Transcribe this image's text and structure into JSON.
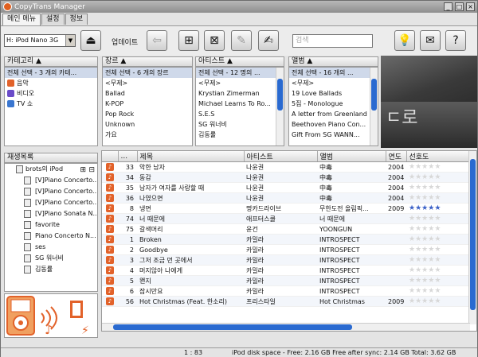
{
  "window": {
    "title": "CopyTrans Manager"
  },
  "tabs": [
    "메인 메뉴",
    "설정",
    "정보"
  ],
  "toolbar": {
    "device": "H: iPod Nano 3G",
    "update_label": "업데이트",
    "search_placeholder": "검색",
    "icons": [
      "eject-icon",
      "update-icon",
      "add-track-icon",
      "delete-track-icon",
      "edit-tags-icon",
      "edit-icon",
      "tips-icon",
      "mail-icon",
      "help-icon"
    ]
  },
  "categories": {
    "header": "카테고리",
    "items": [
      "전체 선택 - 3 개의 카테...",
      "음악",
      "비디오",
      "TV 쇼"
    ],
    "icon_colors": [
      "",
      "#e2622a",
      "#6a4bc9",
      "#3a76d0"
    ]
  },
  "genres": {
    "header": "장르",
    "items": [
      "전체 선택 - 6 개의 장르",
      "<무제>",
      "Ballad",
      "K-POP",
      "Pop Rock",
      "Unknown",
      "가요"
    ]
  },
  "artists": {
    "header": "아티스트",
    "items": [
      "전체 선택 - 12 명의 ...",
      "<무제>",
      "Krystian Zimerman",
      "Michael Learns To Ro...",
      "S.E.S",
      "SG 워너비",
      "김동률"
    ]
  },
  "albums": {
    "header": "앨범",
    "items": [
      "전체 선택 - 16 개의 ...",
      "<무제>",
      "19 Love Ballads",
      "5집 - Monologue",
      "A letter from Greenland",
      "Beethoven Piano Con...",
      "Gift From SG WANN..."
    ]
  },
  "album_art_text": "ㄷ로",
  "playlists": {
    "header": "재생목록",
    "root": "brots의 iPod",
    "items": [
      "[V]Piano Concerto...",
      "[V]Piano Concerto...",
      "[V]Piano Concerto...",
      "[V]Piano Sonata N...",
      "favorite",
      "Piano Concerto N...",
      "ses",
      "SG 워너비",
      "김동률"
    ]
  },
  "grid": {
    "columns": [
      "",
      "...",
      "제목",
      "아티스트",
      "앨범",
      "연도",
      "선호도"
    ],
    "rows": [
      {
        "n": "33",
        "title": "악한 남자",
        "artist": "나윤권",
        "album": "中毒",
        "year": "2004",
        "rating": 0
      },
      {
        "n": "34",
        "title": "동감",
        "artist": "나윤권",
        "album": "中毒",
        "year": "2004",
        "rating": 0
      },
      {
        "n": "35",
        "title": "남자가 여자를 사랑할 때",
        "artist": "나윤권",
        "album": "中毒",
        "year": "2004",
        "rating": 0
      },
      {
        "n": "36",
        "title": "나였으면",
        "artist": "나윤권",
        "album": "中毒",
        "year": "2004",
        "rating": 0
      },
      {
        "n": "8",
        "title": "냉면",
        "artist": "명카드라이브",
        "album": "무한도전 올림픽...",
        "year": "2009",
        "rating": 5
      },
      {
        "n": "74",
        "title": "너 때문에",
        "artist": "애프터스쿨",
        "album": "너 때문에",
        "year": "",
        "rating": 0
      },
      {
        "n": "75",
        "title": "갈색머리",
        "artist": "윤건",
        "album": "YOONGUN",
        "year": "",
        "rating": 0
      },
      {
        "n": "1",
        "title": "Broken",
        "artist": "카밀라",
        "album": "INTROSPECT",
        "year": "",
        "rating": 0
      },
      {
        "n": "2",
        "title": "Goodbye",
        "artist": "카밀라",
        "album": "INTROSPECT",
        "year": "",
        "rating": 0
      },
      {
        "n": "3",
        "title": "그저 조금 먼 곳에서",
        "artist": "카밀라",
        "album": "INTROSPECT",
        "year": "",
        "rating": 0
      },
      {
        "n": "4",
        "title": "머지않아 나에게",
        "artist": "카밀라",
        "album": "INTROSPECT",
        "year": "",
        "rating": 0
      },
      {
        "n": "5",
        "title": "왠지",
        "artist": "카밀라",
        "album": "INTROSPECT",
        "year": "",
        "rating": 0
      },
      {
        "n": "6",
        "title": "잠시만요",
        "artist": "카밀라",
        "album": "INTROSPECT",
        "year": "",
        "rating": 0
      },
      {
        "n": "56",
        "title": "Hot Christmas (Feat. 한소리)",
        "artist": "프리스타일",
        "album": "Hot Christmas",
        "year": "2009",
        "rating": 0
      }
    ]
  },
  "status": {
    "count": "1 : 83",
    "space": "iPod disk space - Free: 2.16 GB Free after sync: 2.14 GB Total: 3.62 GB"
  },
  "colors": {
    "accent": "#2a6ad0",
    "note": "#e2622a",
    "star": "#3b61c8"
  }
}
